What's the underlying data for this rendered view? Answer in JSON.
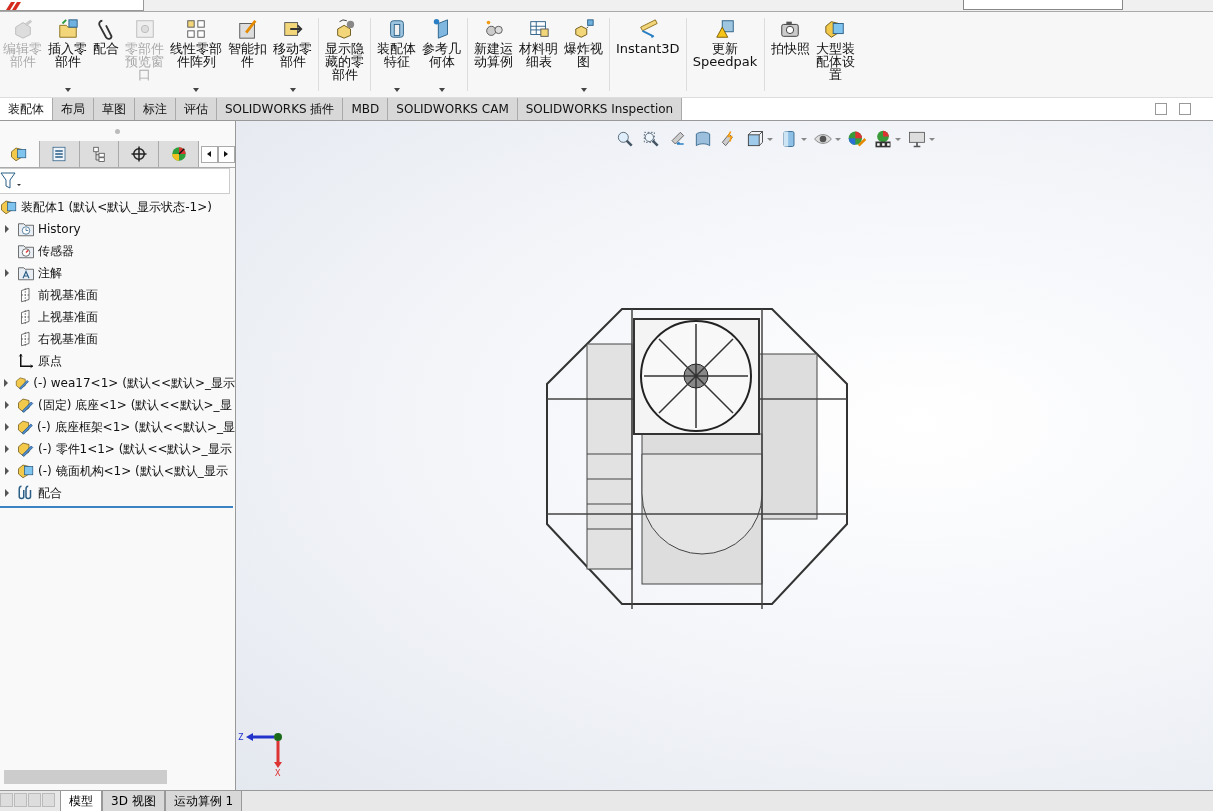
{
  "ribbon": {
    "buttons": [
      {
        "label": "编辑零部件",
        "disabled": true,
        "dropdown": false
      },
      {
        "label": "插入零部件",
        "disabled": false,
        "dropdown": true
      },
      {
        "label": "配合",
        "disabled": false,
        "dropdown": false
      },
      {
        "label": "零部件预览窗口",
        "disabled": true,
        "dropdown": false
      },
      {
        "label": "线性零部件阵列",
        "disabled": false,
        "dropdown": true
      },
      {
        "label": "智能扣件",
        "disabled": false,
        "dropdown": false
      },
      {
        "label": "移动零部件",
        "disabled": false,
        "dropdown": true
      },
      {
        "label": "显示隐藏的零部件",
        "disabled": false,
        "dropdown": false
      },
      {
        "label": "装配体特征",
        "disabled": false,
        "dropdown": true
      },
      {
        "label": "参考几何体",
        "disabled": false,
        "dropdown": true
      },
      {
        "label": "新建运动算例",
        "disabled": false,
        "dropdown": false
      },
      {
        "label": "材料明细表",
        "disabled": false,
        "dropdown": false
      },
      {
        "label": "爆炸视图",
        "disabled": false,
        "dropdown": true
      },
      {
        "label": "Instant3D",
        "disabled": false,
        "dropdown": false
      },
      {
        "label": "更新Speedpak",
        "disabled": false,
        "dropdown": false
      },
      {
        "label": "拍快照",
        "disabled": false,
        "dropdown": false
      },
      {
        "label": "大型装配体设置",
        "disabled": false,
        "dropdown": false
      }
    ]
  },
  "command_tabs": [
    {
      "label": "装配体",
      "selected": true
    },
    {
      "label": "布局",
      "selected": false
    },
    {
      "label": "草图",
      "selected": false
    },
    {
      "label": "标注",
      "selected": false
    },
    {
      "label": "评估",
      "selected": false
    },
    {
      "label": "SOLIDWORKS 插件",
      "selected": false
    },
    {
      "label": "MBD",
      "selected": false
    },
    {
      "label": "SOLIDWORKS CAM",
      "selected": false
    },
    {
      "label": "SOLIDWORKS Inspection",
      "selected": false
    }
  ],
  "panel_tabs": [
    {
      "selected": true
    },
    {
      "selected": false
    },
    {
      "selected": false
    },
    {
      "selected": false
    },
    {
      "selected": false
    }
  ],
  "feature_tree": {
    "label": "装配体1  (默认<默认_显示状态-1>)",
    "kind": "assembly",
    "children": [
      {
        "label": "History",
        "kind": "history",
        "expandable": true
      },
      {
        "label": "传感器",
        "kind": "sensor",
        "expandable": false
      },
      {
        "label": "注解",
        "kind": "annotation",
        "expandable": true
      },
      {
        "label": "前视基准面",
        "kind": "plane",
        "expandable": false
      },
      {
        "label": "上视基准面",
        "kind": "plane",
        "expandable": false
      },
      {
        "label": "右视基准面",
        "kind": "plane",
        "expandable": false
      },
      {
        "label": "原点",
        "kind": "origin",
        "expandable": false
      },
      {
        "label": "(-) wea17<1> (默认<<默认>_显示",
        "kind": "part",
        "expandable": true
      },
      {
        "label": "(固定) 底座<1> (默认<<默认>_显",
        "kind": "part",
        "expandable": true
      },
      {
        "label": "(-) 底座框架<1> (默认<<默认>_显",
        "kind": "part",
        "expandable": true
      },
      {
        "label": "(-) 零件1<1> (默认<<默认>_显示",
        "kind": "part",
        "expandable": true
      },
      {
        "label": "(-) 镜面机构<1> (默认<默认_显示",
        "kind": "assembly",
        "expandable": true
      },
      {
        "label": "配合",
        "kind": "mates",
        "expandable": true
      }
    ]
  },
  "triad": {
    "z_label": "Z",
    "x_label": "X"
  },
  "bottom_tabs": [
    {
      "label": "模型",
      "selected": true
    },
    {
      "label": "3D 视图",
      "selected": false
    },
    {
      "label": "运动算例 1",
      "selected": false
    }
  ]
}
